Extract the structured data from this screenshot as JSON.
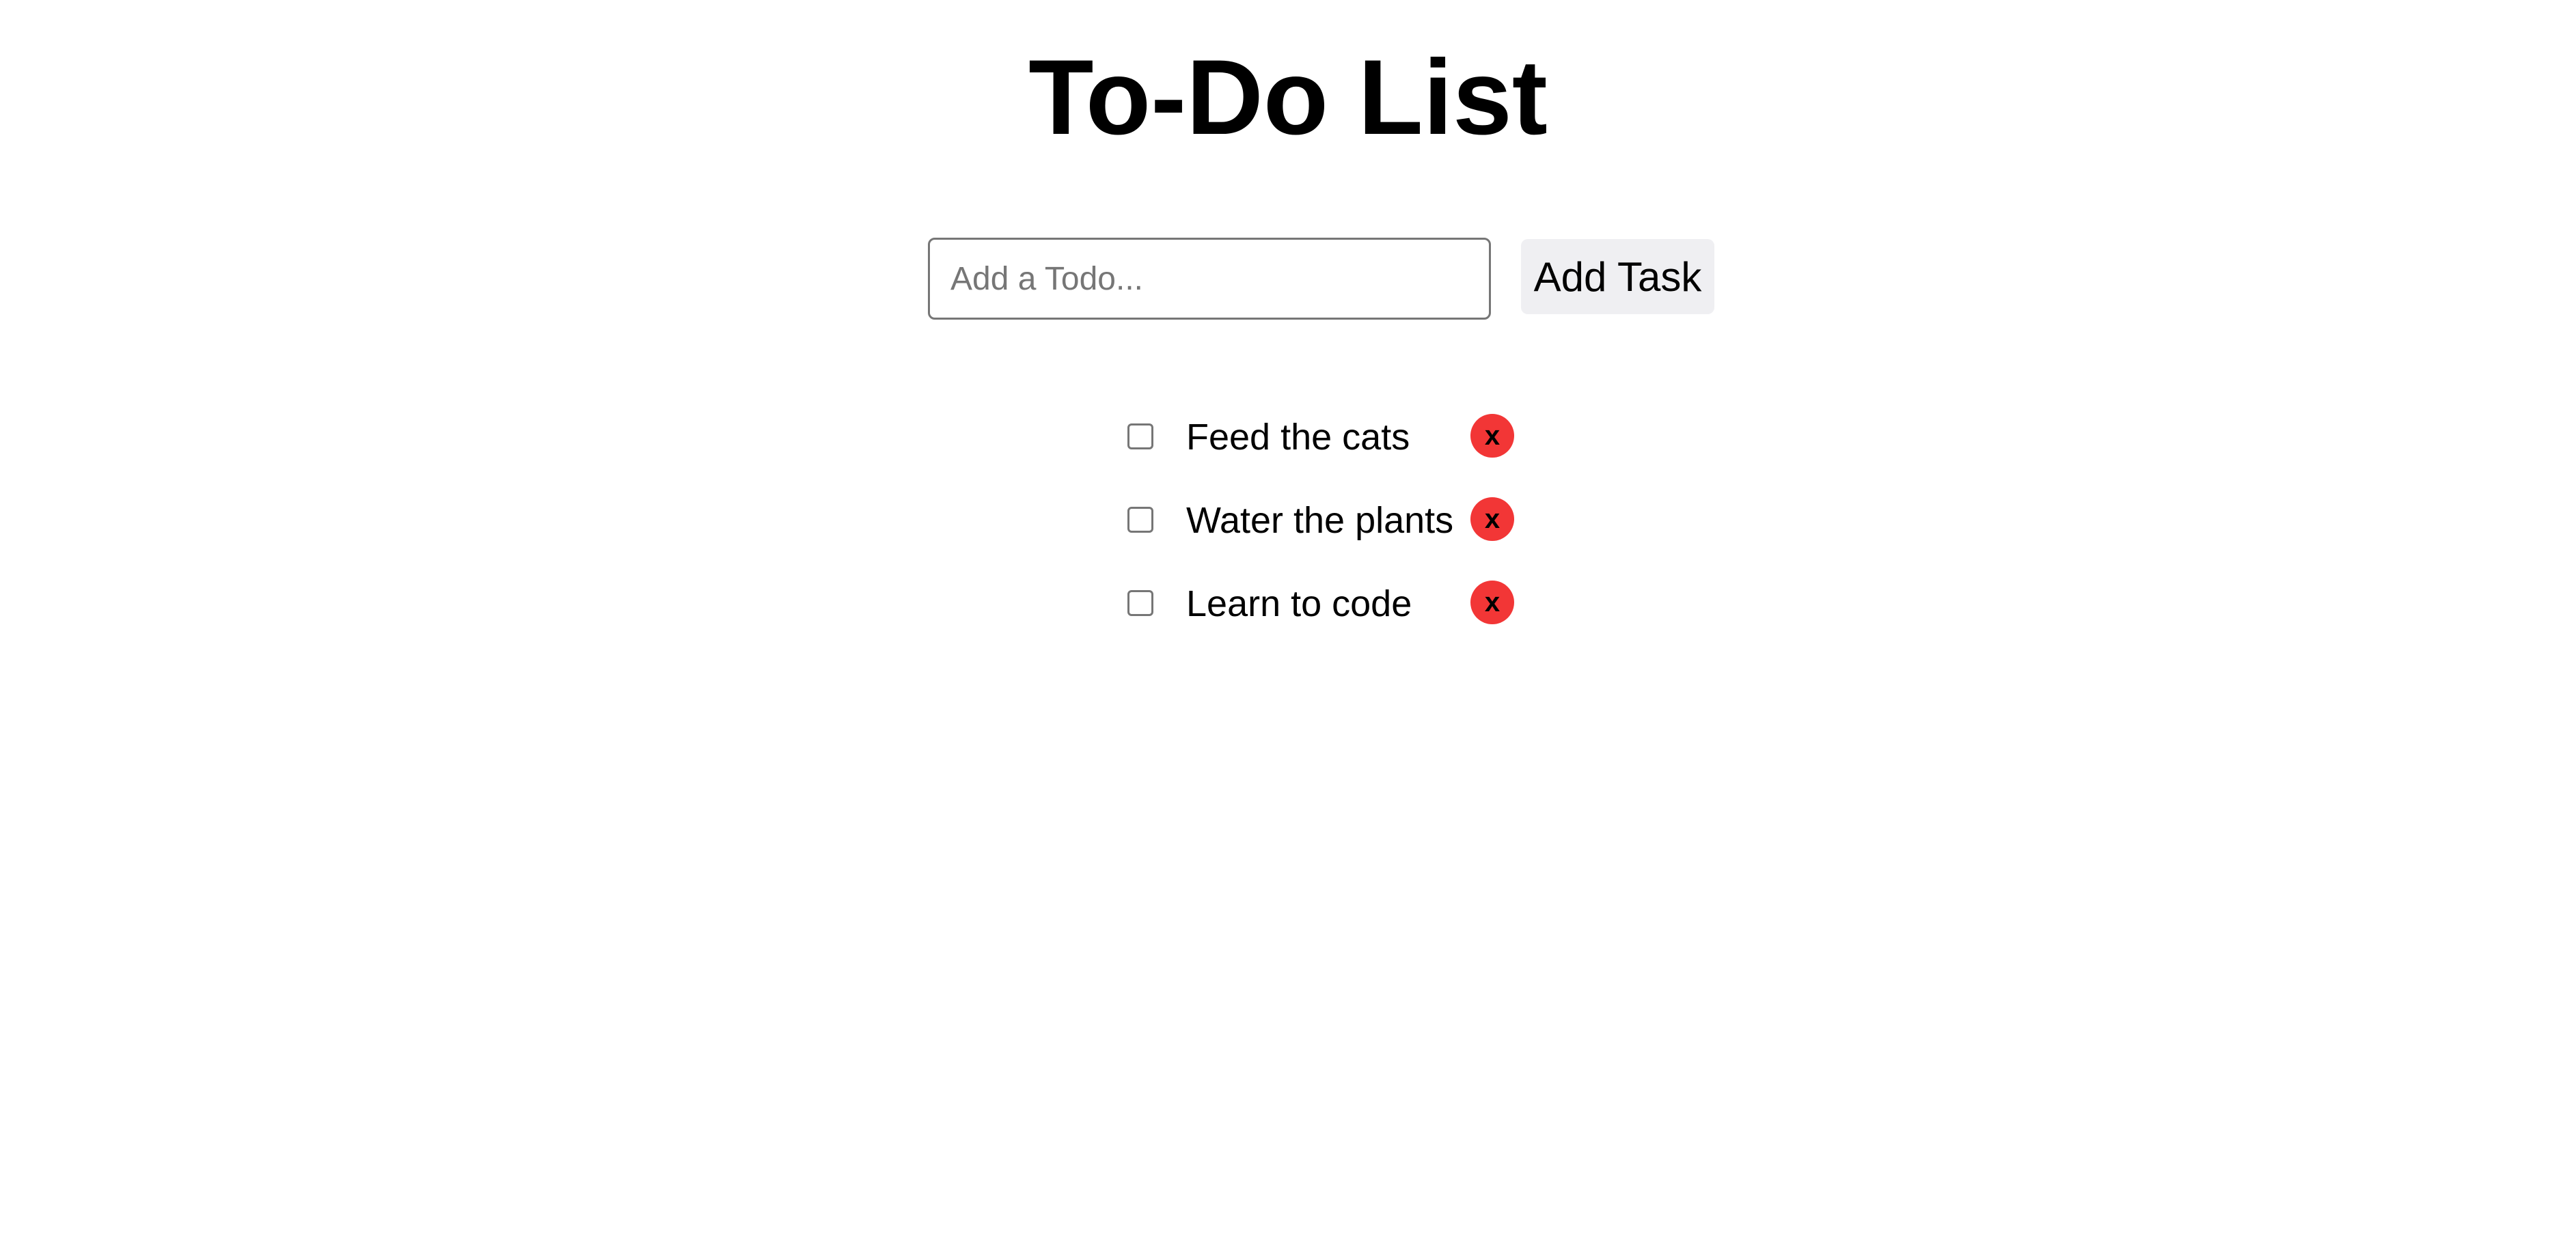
{
  "page": {
    "title": "To-Do List"
  },
  "form": {
    "input_value": "",
    "input_placeholder": "Add a Todo...",
    "add_button_label": "Add Task"
  },
  "todos": [
    {
      "text": "Feed the cats",
      "completed": false,
      "delete_label": "x"
    },
    {
      "text": "Water the plants",
      "completed": false,
      "delete_label": "x"
    },
    {
      "text": "Learn to code",
      "completed": false,
      "delete_label": "x"
    }
  ],
  "colors": {
    "delete_button": "#f23636",
    "add_button_bg": "#efeff2",
    "input_border": "#767676"
  }
}
